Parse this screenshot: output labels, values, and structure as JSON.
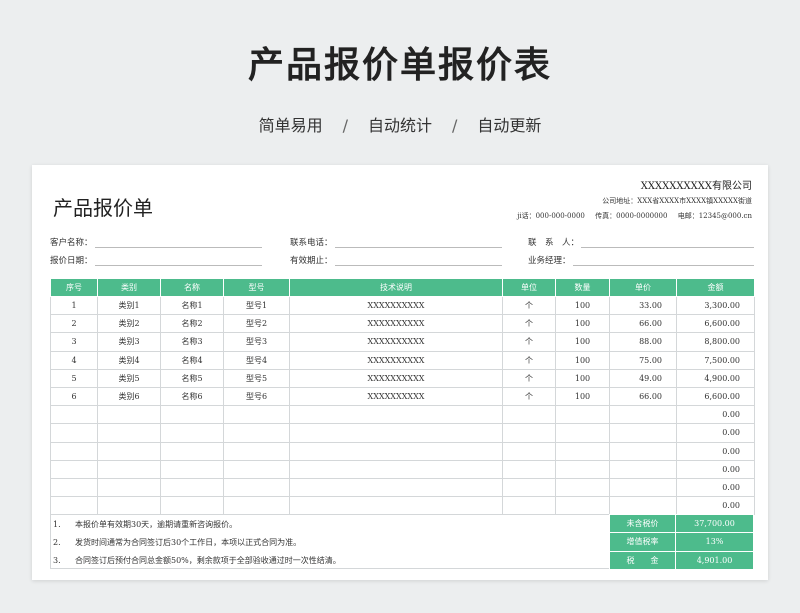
{
  "hero": {
    "title": "产品报价单报价表",
    "features": [
      "简单易用",
      "自动统计",
      "自动更新"
    ],
    "separator": "/"
  },
  "sheet": {
    "title": "产品报价单",
    "company": "XXXXXXXXXX有限公司",
    "address": "公司地址：XXX省XXXX市XXXX镇XXXXX街道",
    "phone": "ji话：000-000-0000",
    "fax": "传真：0000-0000000",
    "email": "电邮：12345@000.cn"
  },
  "fields": {
    "customer_name": "客户名称：",
    "contact_phone": "联系电话：",
    "contact_person": "联　系　人：",
    "quote_date": "报价日期：",
    "valid_until": "有效期止：",
    "manager": "业务经理："
  },
  "table": {
    "headers": [
      "序号",
      "类别",
      "名称",
      "型号",
      "技术说明",
      "单位",
      "数量",
      "单价",
      "金额"
    ],
    "rows": [
      [
        "1",
        "类别1",
        "名称1",
        "型号1",
        "XXXXXXXXXX",
        "个",
        "100",
        "33.00",
        "3,300.00"
      ],
      [
        "2",
        "类别2",
        "名称2",
        "型号2",
        "XXXXXXXXXX",
        "个",
        "100",
        "66.00",
        "6,600.00"
      ],
      [
        "3",
        "类别3",
        "名称3",
        "型号3",
        "XXXXXXXXXX",
        "个",
        "100",
        "88.00",
        "8,800.00"
      ],
      [
        "4",
        "类别4",
        "名称4",
        "型号4",
        "XXXXXXXXXX",
        "个",
        "100",
        "75.00",
        "7,500.00"
      ],
      [
        "5",
        "类别5",
        "名称5",
        "型号5",
        "XXXXXXXXXX",
        "个",
        "100",
        "49.00",
        "4,900.00"
      ],
      [
        "6",
        "类别6",
        "名称6",
        "型号6",
        "XXXXXXXXXX",
        "个",
        "100",
        "66.00",
        "6,600.00"
      ],
      [
        "",
        "",
        "",
        "",
        "",
        "",
        "",
        "",
        "0.00"
      ],
      [
        "",
        "",
        "",
        "",
        "",
        "",
        "",
        "",
        "0.00"
      ],
      [
        "",
        "",
        "",
        "",
        "",
        "",
        "",
        "",
        "0.00"
      ],
      [
        "",
        "",
        "",
        "",
        "",
        "",
        "",
        "",
        "0.00"
      ],
      [
        "",
        "",
        "",
        "",
        "",
        "",
        "",
        "",
        "0.00"
      ],
      [
        "",
        "",
        "",
        "",
        "",
        "",
        "",
        "",
        "0.00"
      ]
    ]
  },
  "notes": [
    {
      "num": "1.",
      "text": "本报价单有效期30天，逾期请重新咨询报价。"
    },
    {
      "num": "2.",
      "text": "发货时间通常为合同签订后30个工作日，本项以正式合同为准。"
    },
    {
      "num": "3.",
      "text": "合同签订后预付合同总金额50%，剩余款项于全部验收通过时一次性结清。"
    }
  ],
  "totals": [
    {
      "label": "未含税价",
      "value": "37,700.00"
    },
    {
      "label": "增值税率",
      "value": "13%"
    },
    {
      "label": "税　　金",
      "value": "4,901.00"
    }
  ],
  "colors": {
    "accent": "#4dbb8c",
    "background": "#eceeef"
  }
}
